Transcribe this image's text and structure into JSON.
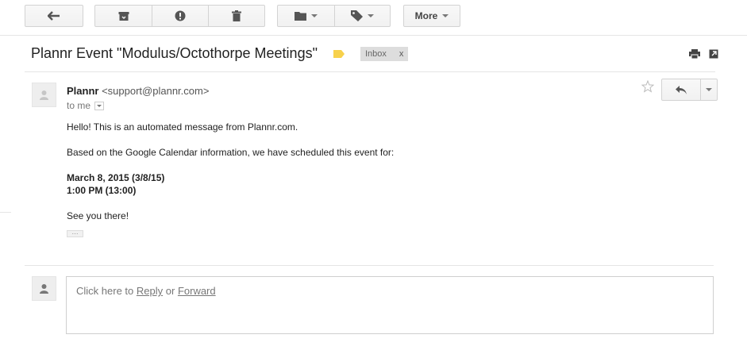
{
  "toolbar": {
    "more_label": "More"
  },
  "message": {
    "subject": "Plannr Event \"Modulus/Octothorpe Meetings\"",
    "label_chip": "Inbox",
    "label_chip_close": "x",
    "sender_name": "Plannr",
    "sender_email": "<support@plannr.com>",
    "recipient": "to me",
    "body": {
      "line1": "Hello! This is an automated message from Plannr.com.",
      "line2": "Based on the Google Calendar information, we have scheduled this event for:",
      "date": "March 8, 2015 (3/8/15)",
      "time": "1:00 PM (13:00)",
      "line3": "See you there!",
      "trimmed": "···"
    }
  },
  "reply_box": {
    "prefix": "Click here to",
    "reply": "Reply",
    "or": "or",
    "forward": "Forward"
  },
  "colors": {
    "label_important": "#f7d14c",
    "chip_bg": "#dddddd",
    "border": "#d3d3d3"
  },
  "icons": [
    "back-arrow-icon",
    "archive-icon",
    "report-spam-icon",
    "delete-icon",
    "folder-icon",
    "tag-icon",
    "print-icon",
    "new-window-icon",
    "person-icon",
    "star-icon",
    "reply-icon"
  ]
}
